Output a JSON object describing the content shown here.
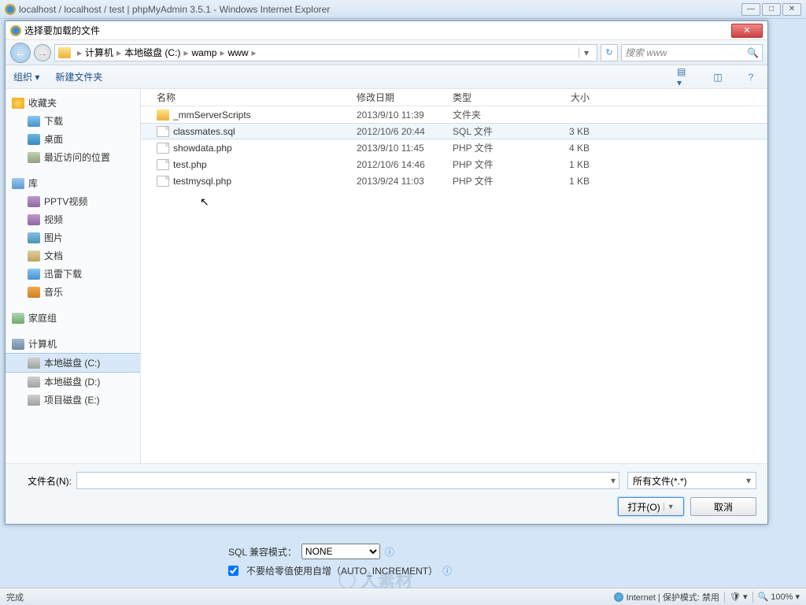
{
  "browser": {
    "title": "localhost / localhost / test | phpMyAdmin 3.5.1 - Windows Internet Explorer"
  },
  "dialog": {
    "title": "选择要加载的文件",
    "breadcrumb": [
      "计算机",
      "本地磁盘 (C:)",
      "wamp",
      "www"
    ],
    "search_placeholder": "搜索 www",
    "toolbar": {
      "organize": "组织 ▾",
      "newfolder": "新建文件夹"
    },
    "sidebar": {
      "favorites": {
        "head": "收藏夹",
        "items": [
          "下载",
          "桌面",
          "最近访问的位置"
        ]
      },
      "libraries": {
        "head": "库",
        "items": [
          "PPTV视频",
          "视频",
          "图片",
          "文档",
          "迅雷下载",
          "音乐"
        ]
      },
      "homegroup": "家庭组",
      "computer": {
        "head": "计算机",
        "items": [
          "本地磁盘 (C:)",
          "本地磁盘 (D:)",
          "项目磁盘 (E:)"
        ]
      }
    },
    "columns": {
      "name": "名称",
      "date": "修改日期",
      "type": "类型",
      "size": "大小"
    },
    "files": [
      {
        "name": "_mmServerScripts",
        "date": "2013/9/10 11:39",
        "type": "文件夹",
        "size": "",
        "folder": true
      },
      {
        "name": "classmates.sql",
        "date": "2012/10/6 20:44",
        "type": "SQL 文件",
        "size": "3 KB",
        "selected": true
      },
      {
        "name": "showdata.php",
        "date": "2013/9/10 11:45",
        "type": "PHP 文件",
        "size": "4 KB"
      },
      {
        "name": "test.php",
        "date": "2012/10/6 14:46",
        "type": "PHP 文件",
        "size": "1 KB"
      },
      {
        "name": "testmysql.php",
        "date": "2013/9/24 11:03",
        "type": "PHP 文件",
        "size": "1 KB"
      }
    ],
    "filename_label": "文件名(N):",
    "filter": "所有文件(*.*)",
    "open": "打开(O)",
    "cancel": "取消"
  },
  "behind": {
    "sql_compat_label": "SQL 兼容模式：",
    "sql_compat_value": "NONE",
    "auto_increment": "不要给零值使用自增（AUTO_INCREMENT）"
  },
  "status": {
    "done": "完成",
    "zone": "Internet | 保护模式: 禁用",
    "zoom": "100%"
  }
}
